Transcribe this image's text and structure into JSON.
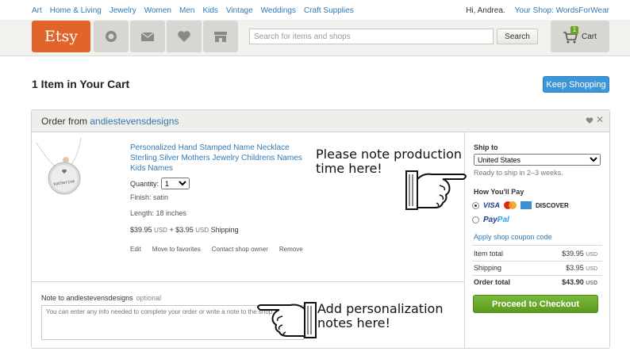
{
  "topnav": {
    "categories": [
      "Art",
      "Home & Living",
      "Jewelry",
      "Women",
      "Men",
      "Kids",
      "Vintage",
      "Weddings",
      "Craft Supplies"
    ],
    "greeting": "Hi, Andrea.",
    "your_shop": "Your Shop: WordsForWear"
  },
  "header": {
    "logo": "Etsy",
    "icons": [
      "circle-icon",
      "mail-icon",
      "heart-icon",
      "shop-icon"
    ],
    "search_placeholder": "Search for items and shops",
    "search_button": "Search",
    "cart_count": "1",
    "cart_label": "Cart"
  },
  "page": {
    "title": "1 Item in Your Cart",
    "keep_shopping": "Keep Shopping"
  },
  "order": {
    "from_label": "Order from",
    "shop_name": "andiestevensdesigns",
    "item": {
      "title": "Personalized Hand Stamped Name Necklace Sterling Silver Mothers Jewelry Childrens Names Kids Names",
      "quantity_label": "Quantity:",
      "quantity_value": "1",
      "finish": "Finish: satin",
      "length": "Length: 18 inches",
      "price": "$39.95",
      "price_currency": "USD",
      "shipping_prefix": "+ $3.95",
      "shipping_currency": "USD",
      "shipping_suffix": "Shipping",
      "links": [
        "Edit",
        "Move to favorites",
        "Contact shop owner",
        "Remove"
      ],
      "stamp_text": "katherine"
    },
    "note": {
      "label": "Note to andiestevensdesigns",
      "optional": "optional",
      "placeholder": "You can enter any info needed to complete your order or write a note to the shop"
    },
    "summary": {
      "ship_to_label": "Ship to",
      "country": "United States",
      "ready": "Ready to ship in 2–3 weeks.",
      "how_pay_label": "How You'll Pay",
      "card_labels": [
        "VISA",
        "DISCOVER"
      ],
      "paypal_a": "Pay",
      "paypal_b": "Pal",
      "coupon": "Apply shop coupon code",
      "item_total_label": "Item total",
      "item_total_value": "$39.95",
      "shipping_label": "Shipping",
      "shipping_value": "$3.95",
      "order_total_label": "Order total",
      "order_total_value": "$43.90",
      "currency": "USD",
      "checkout": "Proceed to Checkout"
    }
  },
  "annotations": {
    "production": "Please note production time here!",
    "personalization": "Add personalization notes here!"
  },
  "colors": {
    "etsy_orange": "#e1642a",
    "link_blue": "#3079b8",
    "checkout_green": "#68a525",
    "keep_shopping_blue": "#3d95d6"
  }
}
